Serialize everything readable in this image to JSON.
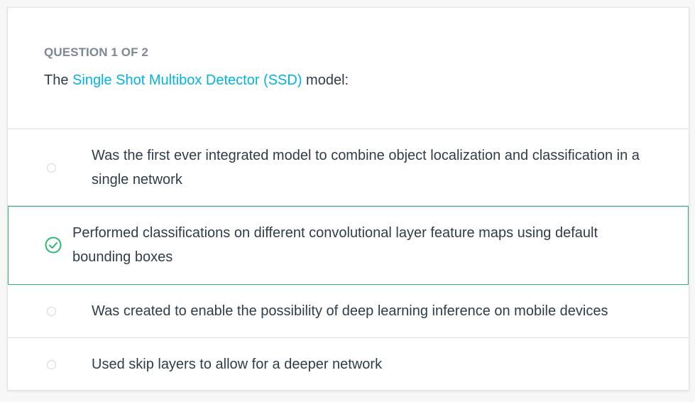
{
  "question": {
    "counter": "QUESTION 1 OF 2",
    "prompt_prefix": "The ",
    "prompt_link": "Single Shot Multibox Detector (SSD)",
    "prompt_suffix": " model:"
  },
  "options": [
    {
      "text": "Was the first ever integrated model to combine object localization and classification in a single network",
      "selected": false
    },
    {
      "text": "Performed classifications on different convolutional layer feature maps using default bounding boxes",
      "selected": true
    },
    {
      "text": "Was created to enable the possibility of deep learning inference on mobile devices",
      "selected": false
    },
    {
      "text": "Used skip layers to allow for a deeper network",
      "selected": false
    }
  ],
  "colors": {
    "link": "#02b3e4",
    "selected_border": "#2cb872",
    "text": "#2e3d49",
    "counter": "#7d8894"
  },
  "icons": {
    "selected": "check-circle-icon",
    "unselected": "radio-circle-icon"
  }
}
